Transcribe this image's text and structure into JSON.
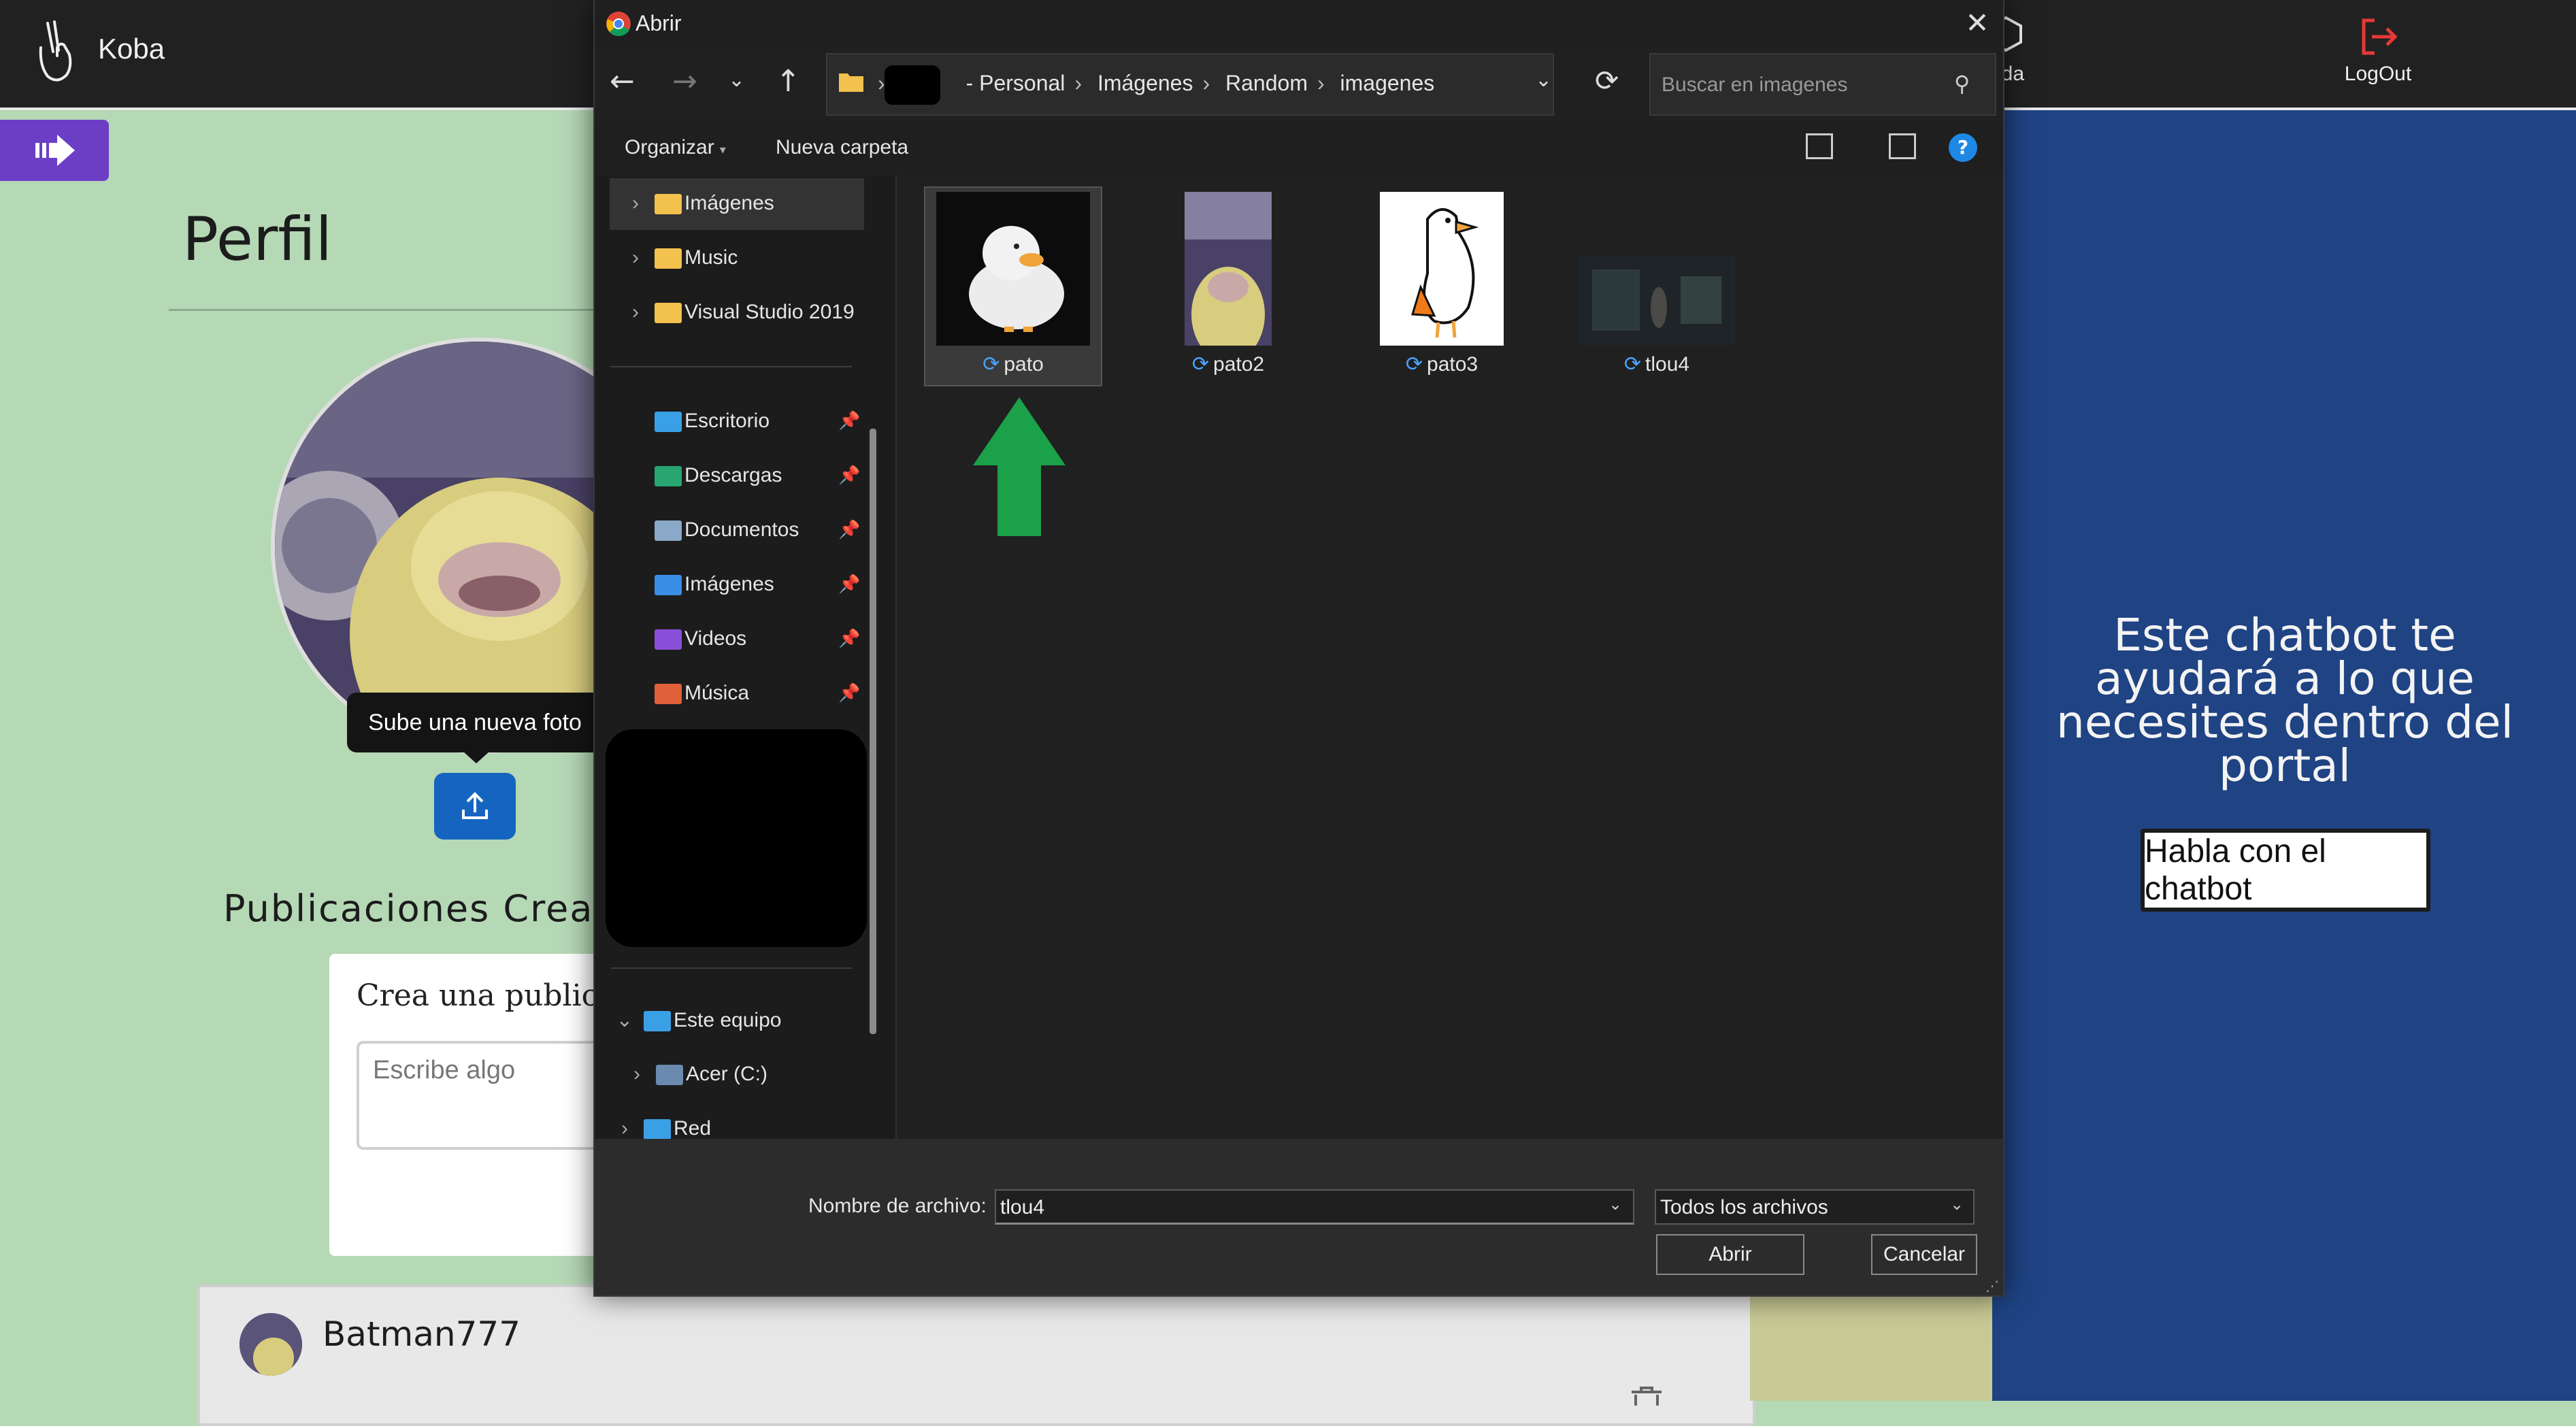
{
  "app": {
    "name": "Koba"
  },
  "navbar": {
    "help_label": "uda",
    "logout_label": "LogOut"
  },
  "profile": {
    "title": "Perfil",
    "upload_tooltip": "Sube una nueva foto",
    "publications_heading": "Publicaciones Crea",
    "create_card_title": "Crea una publicac",
    "write_placeholder": "Escribe algo"
  },
  "post": {
    "username": "Batman777"
  },
  "chatbot": {
    "text": "Este chatbot te ayudará a lo que necesites dentro del portal",
    "button_label": "Habla con el chatbot"
  },
  "dialog": {
    "title": "Abrir",
    "breadcrumb": [
      "- Personal",
      "Imágenes",
      "Random",
      "imagenes"
    ],
    "search_placeholder": "Buscar en imagenes",
    "toolbar": {
      "organize": "Organizar",
      "new_folder": "Nueva carpeta"
    },
    "nav_items": [
      {
        "label": "Imágenes",
        "icon": "folder-icon"
      },
      {
        "label": "Music",
        "icon": "folder-icon"
      },
      {
        "label": "Visual Studio 2019",
        "icon": "folder-icon"
      },
      {
        "label": "Escritorio",
        "icon": "desktop-icon"
      },
      {
        "label": "Descargas",
        "icon": "downloads-icon"
      },
      {
        "label": "Documentos",
        "icon": "documents-icon"
      },
      {
        "label": "Imágenes",
        "icon": "pictures-icon"
      },
      {
        "label": "Videos",
        "icon": "videos-icon"
      },
      {
        "label": "Música",
        "icon": "music-icon"
      },
      {
        "label": "Este equipo",
        "icon": "pc-icon"
      },
      {
        "label": "Acer (C:)",
        "icon": "drive-icon"
      },
      {
        "label": "Red",
        "icon": "network-icon"
      }
    ],
    "files": [
      {
        "name": "pato"
      },
      {
        "name": "pato2"
      },
      {
        "name": "pato3"
      },
      {
        "name": "tlou4"
      }
    ],
    "filename_label": "Nombre de archivo:",
    "filename_value": "tlou4",
    "filetype_value": "Todos los archivos",
    "open_label": "Abrir",
    "cancel_label": "Cancelar"
  },
  "colors": {
    "page_bg": "#b5d8b5",
    "navbar_bg": "#212121",
    "right_panel_bg": "#1f4383",
    "toggle_button": "#6c3ec6",
    "upload_button": "#1565c0",
    "arrow_green": "#1aa14a",
    "logout_red": "#e53935"
  }
}
